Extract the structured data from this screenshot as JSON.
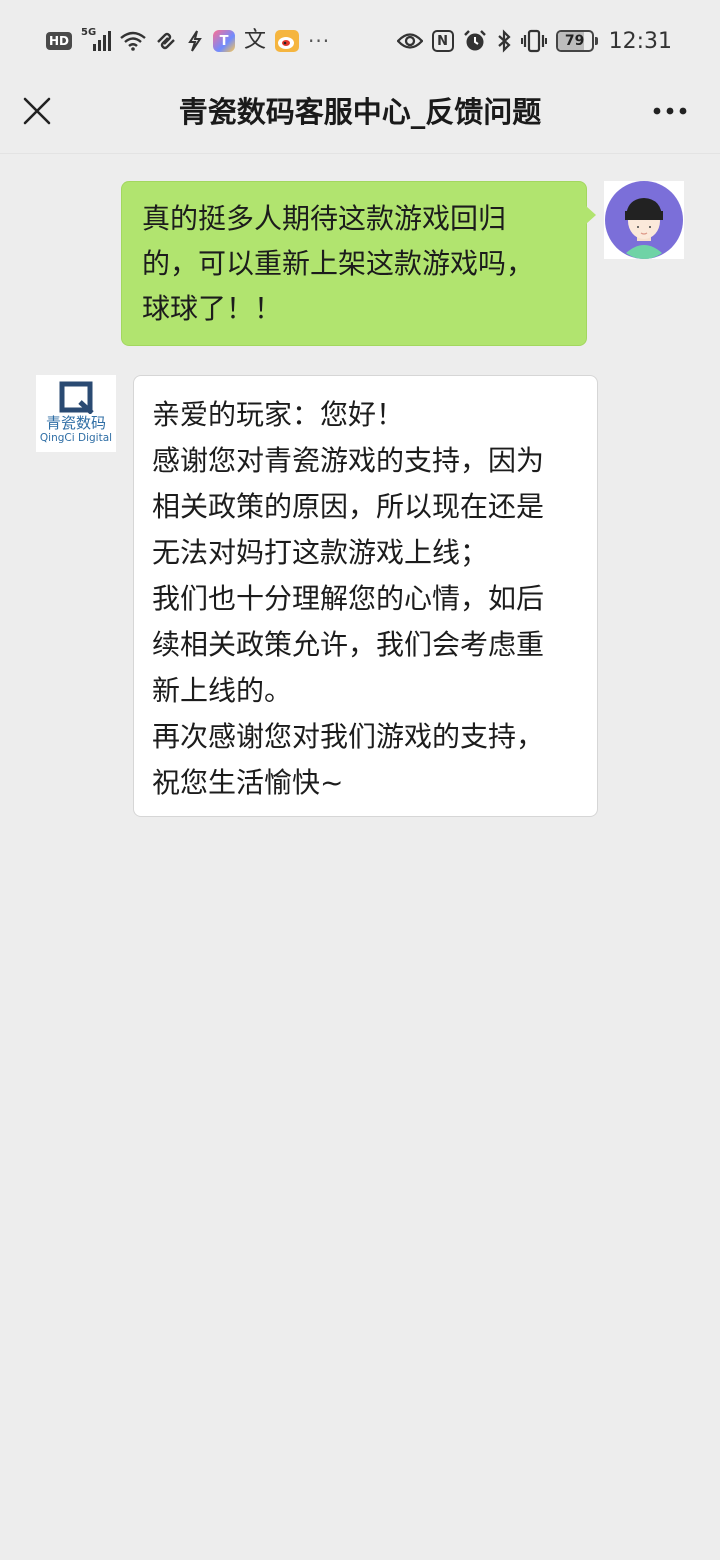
{
  "status_bar": {
    "hd_label": "HD",
    "network_label": "5G",
    "app_tile_label": "T",
    "translate_glyph": "文",
    "more_label": "···",
    "nfc_label": "N",
    "battery_level": "79",
    "battery_fraction": 0.79,
    "time": "12:31",
    "icons": [
      "hd-icon",
      "signal-icon",
      "wifi-icon",
      "link-icon",
      "bolt-icon",
      "app-icon",
      "translate-icon",
      "weibo-icon",
      "more-notifications-icon",
      "eye-icon",
      "nfc-icon",
      "alarm-icon",
      "bluetooth-icon",
      "vibrate-icon",
      "battery-icon"
    ]
  },
  "header": {
    "title": "青瓷数码客服中心_反馈问题",
    "close_icon": "close-icon",
    "more_icon": "more-icon"
  },
  "chat": {
    "messages": [
      {
        "direction": "outgoing",
        "text": "真的挺多人期待这款游戏回归\n的，可以重新上架这款游戏吗，\n球球了！！",
        "avatar": "user-avatar"
      },
      {
        "direction": "incoming",
        "avatar_logo_cn": "青瓷数码",
        "avatar_logo_en": "QingCi Digital",
        "text": "亲爱的玩家：您好！\n感谢您对青瓷游戏的支持，因为\n相关政策的原因，所以现在还是\n无法对妈打这款游戏上线；\n我们也十分理解您的心情，如后\n续相关政策允许，我们会考虑重\n新上线的。\n再次感谢您对我们游戏的支持，\n祝您生活愉快~"
      }
    ]
  },
  "colors": {
    "background": "#ededed",
    "outgoing_bubble": "#b1e46f",
    "incoming_bubble": "#ffffff",
    "user_avatar_bg": "#7b6fd9",
    "logo_blue": "#2f6ea5"
  }
}
